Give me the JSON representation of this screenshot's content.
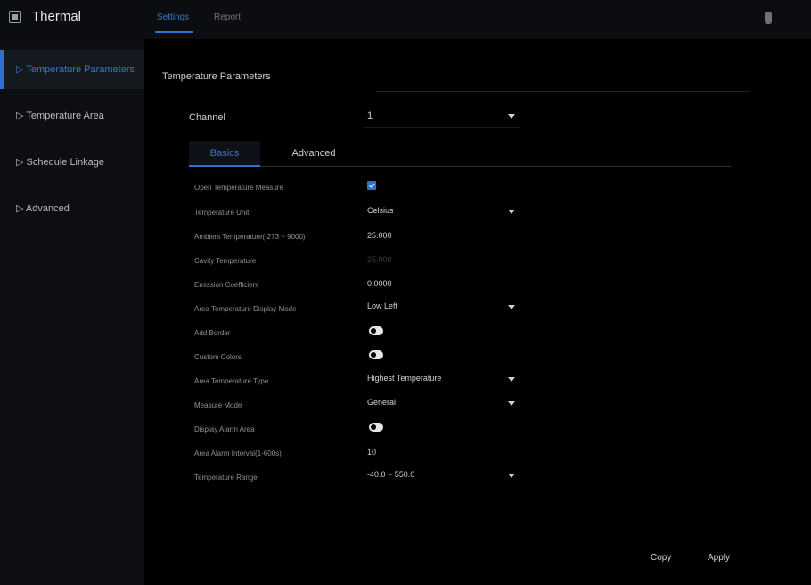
{
  "app": {
    "title": "Thermal"
  },
  "top_tabs": [
    {
      "label": "Settings"
    },
    {
      "label": "Report"
    }
  ],
  "sidebar": {
    "items": [
      {
        "label": "Temperature Parameters"
      },
      {
        "label": "Temperature Area"
      },
      {
        "label": "Schedule Linkage"
      },
      {
        "label": "Advanced"
      }
    ]
  },
  "main": {
    "section_title": "Temperature Parameters",
    "channel": {
      "label": "Channel",
      "value": "1"
    },
    "sub_tabs": [
      {
        "label": "Basics"
      },
      {
        "label": "Advanced"
      }
    ],
    "rows": {
      "open_measure": {
        "label": "Open Temperature Measure"
      },
      "unit": {
        "label": "Temperature Unit",
        "value": "Celsius"
      },
      "ambient": {
        "label": "Ambient Temperature(-273 ~ 9000)",
        "value": "25.000"
      },
      "cavity": {
        "label": "Cavity Temperature",
        "value": "25.000"
      },
      "emission": {
        "label": "Emission Coefficient",
        "value": "0.0000"
      },
      "display_mode": {
        "label": "Area Temperature Display Mode",
        "value": "Low Left"
      },
      "add_border": {
        "label": "Add Border"
      },
      "custom_colors": {
        "label": "Custom Colors"
      },
      "area_type": {
        "label": "Area Temperature Type",
        "value": "Highest Temperature"
      },
      "measure_mode": {
        "label": "Measure Mode",
        "value": "General"
      },
      "alarm_area": {
        "label": "Display Alarm Area"
      },
      "alarm_interval": {
        "label": "Area Alarm Interval(1-600s)",
        "value": "10"
      },
      "range": {
        "label": "Temperature Range",
        "value": "-40.0 ~ 550.0"
      }
    },
    "buttons": {
      "copy": "Copy",
      "apply": "Apply"
    }
  },
  "colors": {
    "accent": "#2f6fd0",
    "background": "#000000",
    "sidebar": "#0c0e11"
  }
}
